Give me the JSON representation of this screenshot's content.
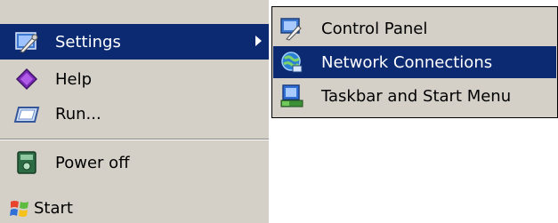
{
  "start_menu": {
    "items": [
      {
        "label": "Settings",
        "icon": "settings-icon",
        "highlighted": true,
        "has_submenu": true
      },
      {
        "label": "Help",
        "icon": "help-book-icon",
        "highlighted": false
      },
      {
        "label": "Run...",
        "icon": "run-icon",
        "highlighted": false
      },
      {
        "label": "Power off",
        "icon": "power-off-icon",
        "highlighted": false
      }
    ]
  },
  "taskbar": {
    "start_label": "Start",
    "start_icon": "windows-logo-icon"
  },
  "submenu": {
    "items": [
      {
        "label": "Control Panel",
        "icon": "control-panel-icon",
        "highlighted": false
      },
      {
        "label": "Network Connections",
        "icon": "network-connections-icon",
        "highlighted": true
      },
      {
        "label": "Taskbar and Start Menu",
        "icon": "taskbar-start-menu-icon",
        "highlighted": false
      }
    ]
  },
  "colors": {
    "menu_background": "#d4d0c8",
    "highlight": "#0b2a72",
    "highlight_text": "#ffffff"
  }
}
